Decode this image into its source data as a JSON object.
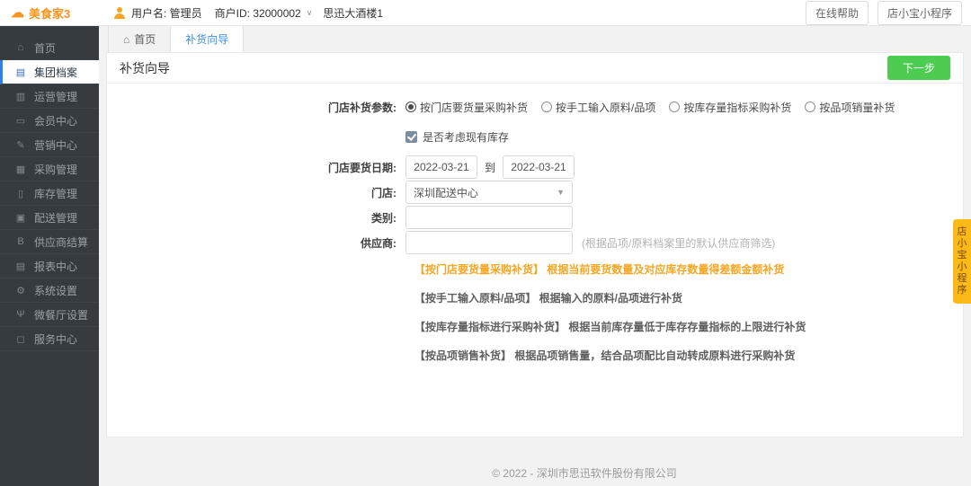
{
  "header": {
    "logo_text": "美食家3",
    "user_label": "用户名: 管理员",
    "merchant_label": "商户ID: 32000002",
    "store_name": "思迅大酒楼1",
    "help_button": "在线帮助",
    "miniprogram_button": "店小宝小程序"
  },
  "icons": {
    "cloud": "☁",
    "caret_down": "∨",
    "select_caret": "▼"
  },
  "sidebar": {
    "items": [
      {
        "label": "首页",
        "icon": "⌂",
        "active": false
      },
      {
        "label": "集团档案",
        "icon": "▤",
        "active": true
      },
      {
        "label": "运营管理",
        "icon": "▥",
        "active": false
      },
      {
        "label": "会员中心",
        "icon": "▭",
        "active": false
      },
      {
        "label": "营销中心",
        "icon": "✎",
        "active": false
      },
      {
        "label": "采购管理",
        "icon": "▦",
        "active": false
      },
      {
        "label": "库存管理",
        "icon": "▯",
        "active": false
      },
      {
        "label": "配送管理",
        "icon": "▣",
        "active": false
      },
      {
        "label": "供应商结算",
        "icon": "B",
        "active": false
      },
      {
        "label": "报表中心",
        "icon": "▤",
        "active": false
      },
      {
        "label": "系统设置",
        "icon": "⚙",
        "active": false
      },
      {
        "label": "微餐厅设置",
        "icon": "Ψ",
        "active": false
      },
      {
        "label": "服务中心",
        "icon": "◻",
        "active": false
      }
    ]
  },
  "tabs": [
    {
      "label": "首页",
      "icon": "⌂",
      "active": false
    },
    {
      "label": "补货向导",
      "icon": "",
      "active": true
    }
  ],
  "page": {
    "title": "补货向导",
    "next_button": "下一步"
  },
  "form": {
    "params_label": "门店补货参数:",
    "radios": [
      {
        "label": "按门店要货量采购补货",
        "checked": true
      },
      {
        "label": "按手工输入原料/品项",
        "checked": false
      },
      {
        "label": "按库存量指标采购补货",
        "checked": false
      },
      {
        "label": "按品项销量补货",
        "checked": false
      }
    ],
    "consider_stock_checkbox": {
      "label": "是否考虑现有库存",
      "checked": true
    },
    "date_label": "门店要货日期:",
    "date_from": "2022-03-21",
    "date_to_word": "到",
    "date_to": "2022-03-21",
    "store_label": "门店:",
    "store_value": "深圳配送中心",
    "category_label": "类别:",
    "category_value": "",
    "supplier_label": "供应商:",
    "supplier_value": "",
    "supplier_hint": "(根据品项/原料档案里的默认供应商筛选)",
    "hints": [
      {
        "text": "【按门店要货量采购补货】 根据当前要货数量及对应库存数量得差额金额补货",
        "highlight": true
      },
      {
        "text": "【按手工输入原料/品项】 根据输入的原料/品项进行补货",
        "highlight": false
      },
      {
        "text": "【按库存量指标进行采购补货】 根据当前库存量低于库存存量指标的上限进行补货",
        "highlight": false
      },
      {
        "text": "【按品项销售补货】 根据品项销售量，结合品项配比自动转成原料进行采购补货",
        "highlight": false
      }
    ]
  },
  "footer": "© 2022 - 深圳市思迅软件股份有限公司",
  "side_tab": "店小宝小程序",
  "colors": {
    "brand_orange": "#f7941d",
    "accent_blue": "#3d8fe0",
    "button_green": "#4ecb51",
    "hint_orange": "#f5a623",
    "sidebar_bg": "#363b3f",
    "side_tab_bg": "#fbba17"
  }
}
